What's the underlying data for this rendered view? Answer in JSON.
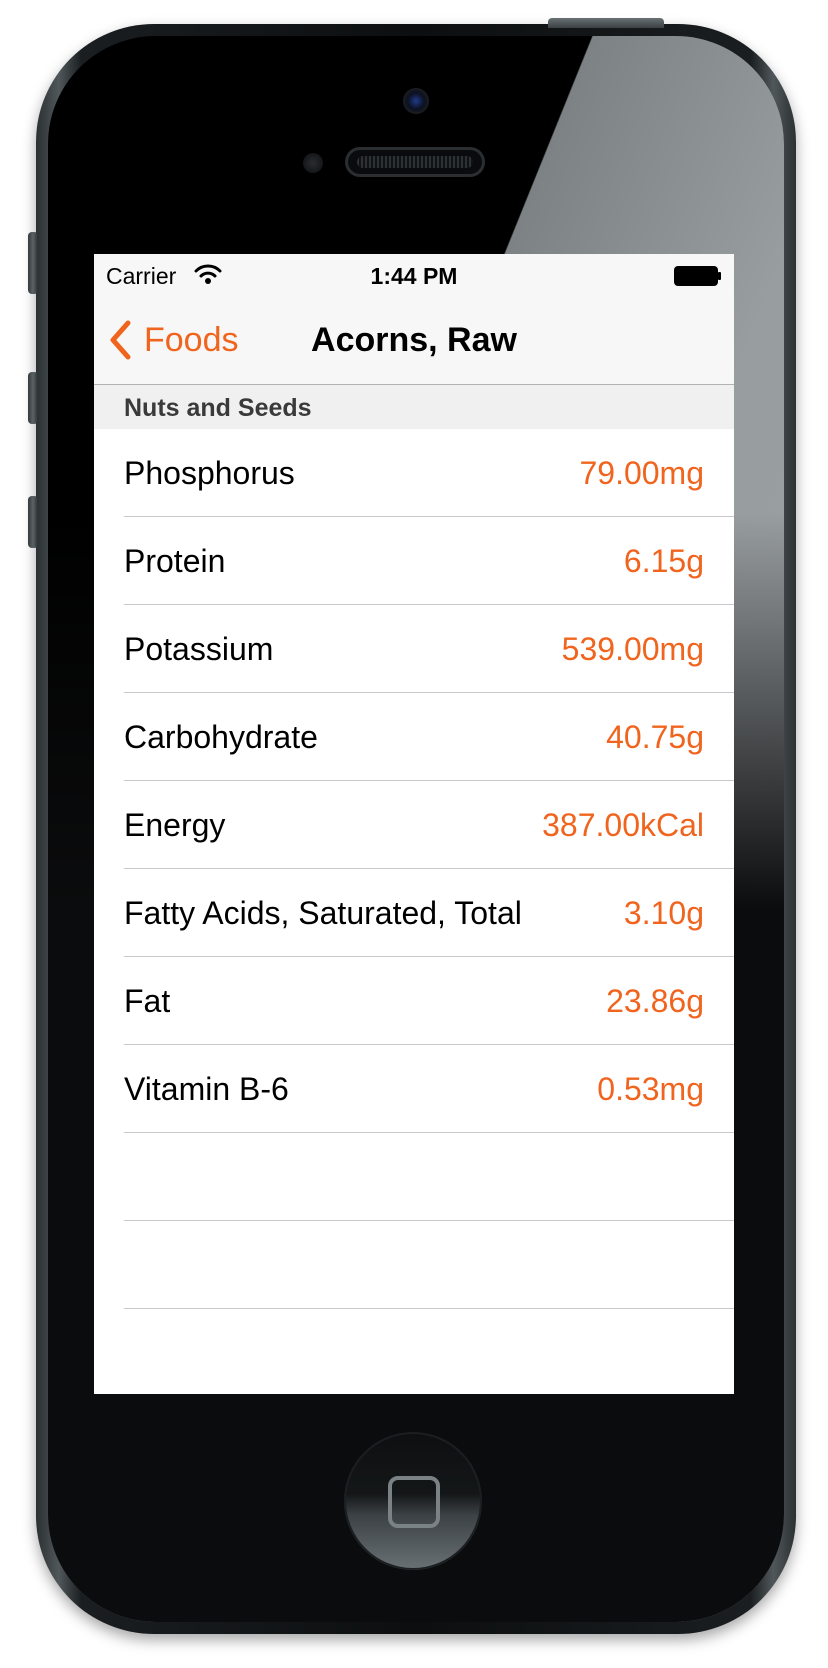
{
  "status_bar": {
    "carrier": "Carrier",
    "time": "1:44 PM"
  },
  "nav": {
    "back_label": "Foods",
    "title": "Acorns, Raw"
  },
  "section": {
    "title": "Nuts and Seeds"
  },
  "nutrients": [
    {
      "name": "Phosphorus",
      "value": "79.00mg"
    },
    {
      "name": "Protein",
      "value": "6.15g"
    },
    {
      "name": "Potassium",
      "value": "539.00mg"
    },
    {
      "name": "Carbohydrate",
      "value": "40.75g"
    },
    {
      "name": "Energy",
      "value": "387.00kCal"
    },
    {
      "name": "Fatty Acids, Saturated, Total",
      "value": "3.10g"
    },
    {
      "name": "Fat",
      "value": "23.86g"
    },
    {
      "name": "Vitamin B-6",
      "value": "0.53mg"
    }
  ],
  "colors": {
    "accent": "#f0641e",
    "separator": "#c8c7cc",
    "nav_background": "#f7f7f7",
    "section_background": "#f0f0f0"
  },
  "icons": {
    "back": "chevron-left-icon",
    "wifi": "wifi-icon",
    "battery": "battery-icon",
    "home": "home-button-icon"
  }
}
